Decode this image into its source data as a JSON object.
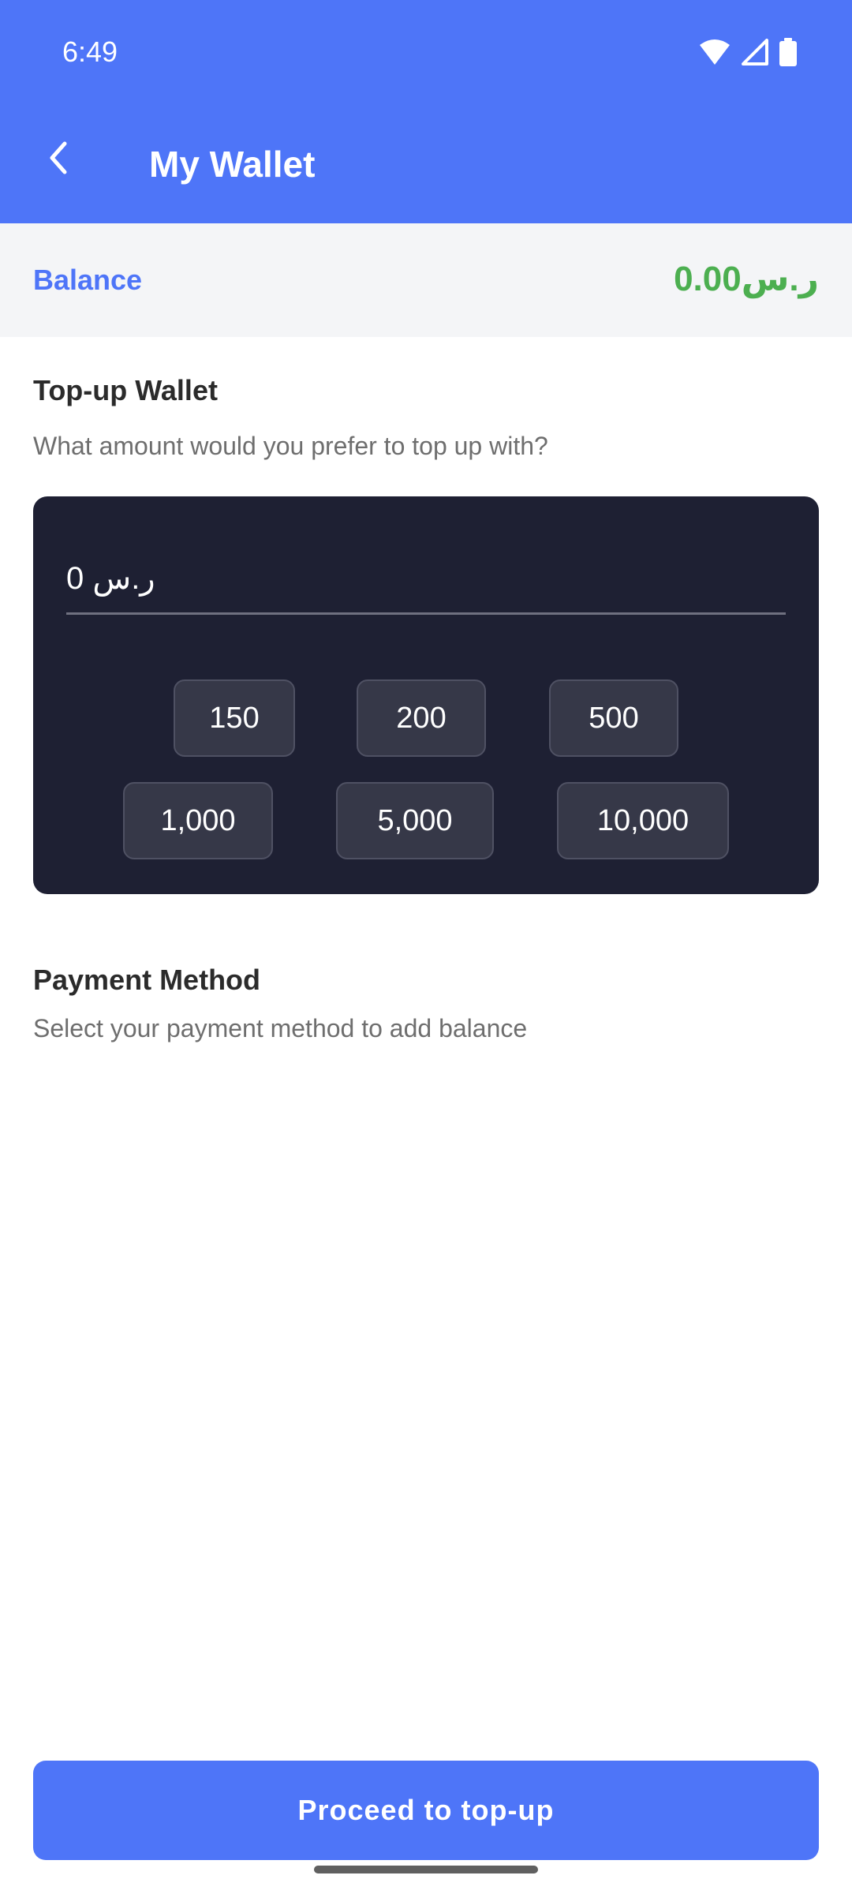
{
  "status_bar": {
    "time": "6:49",
    "icons": [
      "wifi-icon",
      "signal-icon",
      "battery-icon"
    ]
  },
  "app_bar": {
    "title": "My Wallet",
    "back_icon": "chevron-left-icon"
  },
  "balance": {
    "label": "Balance",
    "value": "0.00ر.س"
  },
  "topup": {
    "title": "Top-up Wallet",
    "subtitle": "What amount would you prefer to top up with?",
    "input_value": "0 ر.س",
    "presets": [
      "150",
      "200",
      "500",
      "1,000",
      "5,000",
      "10,000"
    ]
  },
  "payment": {
    "title": "Payment Method",
    "subtitle": "Select your payment method to add balance"
  },
  "action": {
    "proceed_label": "Proceed to top-up"
  },
  "colors": {
    "primary": "#4E75F8",
    "balance_green": "#4CAF50",
    "card_bg": "#1E2033",
    "chip_bg": "#363848"
  }
}
